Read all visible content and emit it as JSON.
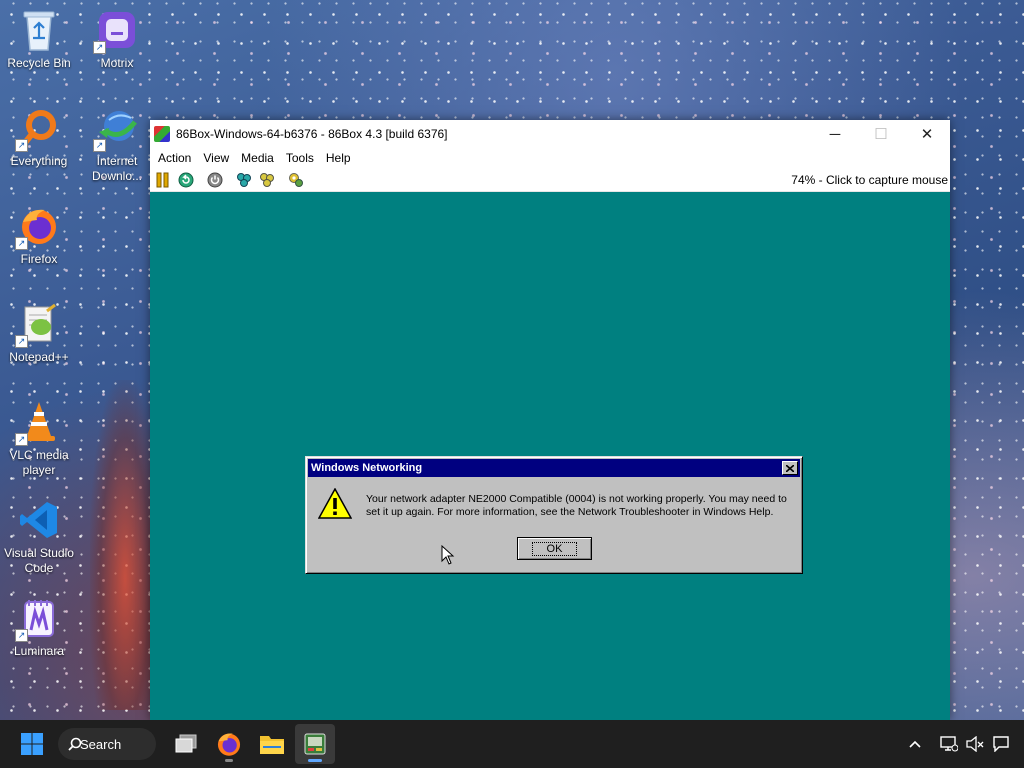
{
  "desktop": {
    "icons": [
      {
        "label": "Recycle Bin",
        "icon": "recycle-bin-icon"
      },
      {
        "label": "Motrix",
        "icon": "motrix-icon"
      },
      {
        "label": "Everything",
        "icon": "everything-search-icon"
      },
      {
        "label": "Internet Downlo...",
        "icon": "internet-download-manager-icon"
      },
      {
        "label": "Firefox",
        "icon": "firefox-icon"
      },
      {
        "label": "Notepad++",
        "icon": "notepad-plus-plus-icon"
      },
      {
        "label": "VLC media player",
        "icon": "vlc-cone-icon"
      },
      {
        "label": "Visual Studio Code",
        "icon": "vscode-icon"
      },
      {
        "label": "Luminara",
        "icon": "luminara-icon"
      }
    ]
  },
  "window": {
    "title": "86Box-Windows-64-b6376 - 86Box 4.3 [build 6376]",
    "controls": {
      "minimize": "─",
      "maximize": "☐",
      "close": "✕"
    },
    "menu": [
      "Action",
      "View",
      "Media",
      "Tools",
      "Help"
    ],
    "toolbar_status": "74% - Click to capture mouse",
    "colors": {
      "screen": "#008080"
    }
  },
  "dialog": {
    "title": "Windows Networking",
    "message": "Your network adapter NE2000 Compatible (0004) is not working properly.  You may need to set it up again. For more information, see the Network Troubleshooter in Windows Help.",
    "ok_label": "OK"
  },
  "taskbar": {
    "search_label": "Search"
  }
}
